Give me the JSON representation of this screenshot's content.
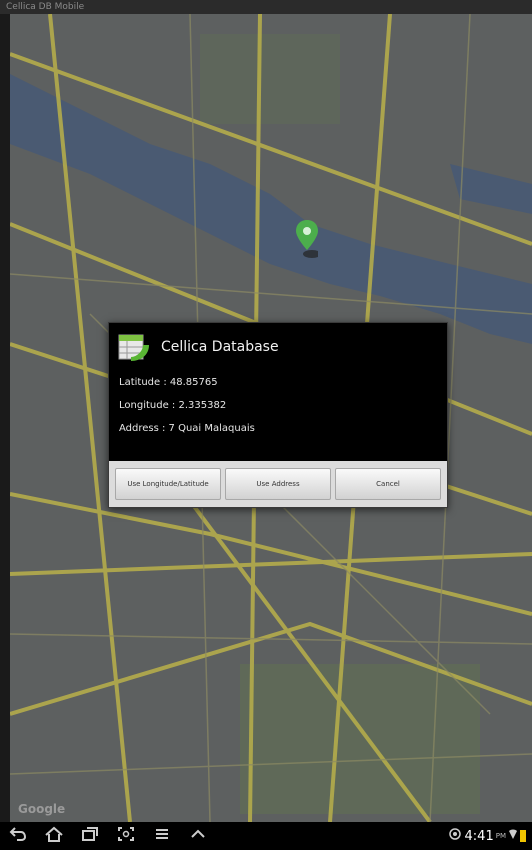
{
  "window": {
    "title": "Cellica DB Mobile"
  },
  "map": {
    "attribution": "Google"
  },
  "dialog": {
    "title": "Cellica Database",
    "latitude_text": "Latitude : 48.85765",
    "longitude_text": "Longitude : 2.335382",
    "address_text": "Address : 7 Quai Malaquais",
    "buttons": {
      "use_longlat": "Use Longitude/Latitude",
      "use_address": "Use Address",
      "cancel": "Cancel"
    }
  },
  "statusbar": {
    "time": "4:41",
    "ampm": "PM"
  },
  "icons": {
    "back": "back-icon",
    "home": "home-icon",
    "recent": "recent-apps-icon",
    "screenshot": "screenshot-icon",
    "menu": "menu-icon",
    "up": "chevron-up-icon"
  },
  "colors": {
    "water": "#4a5a72",
    "road": "#b9b04a",
    "land": "#5d6060",
    "park": "#5f6a58",
    "pin": "#4cae4c"
  }
}
